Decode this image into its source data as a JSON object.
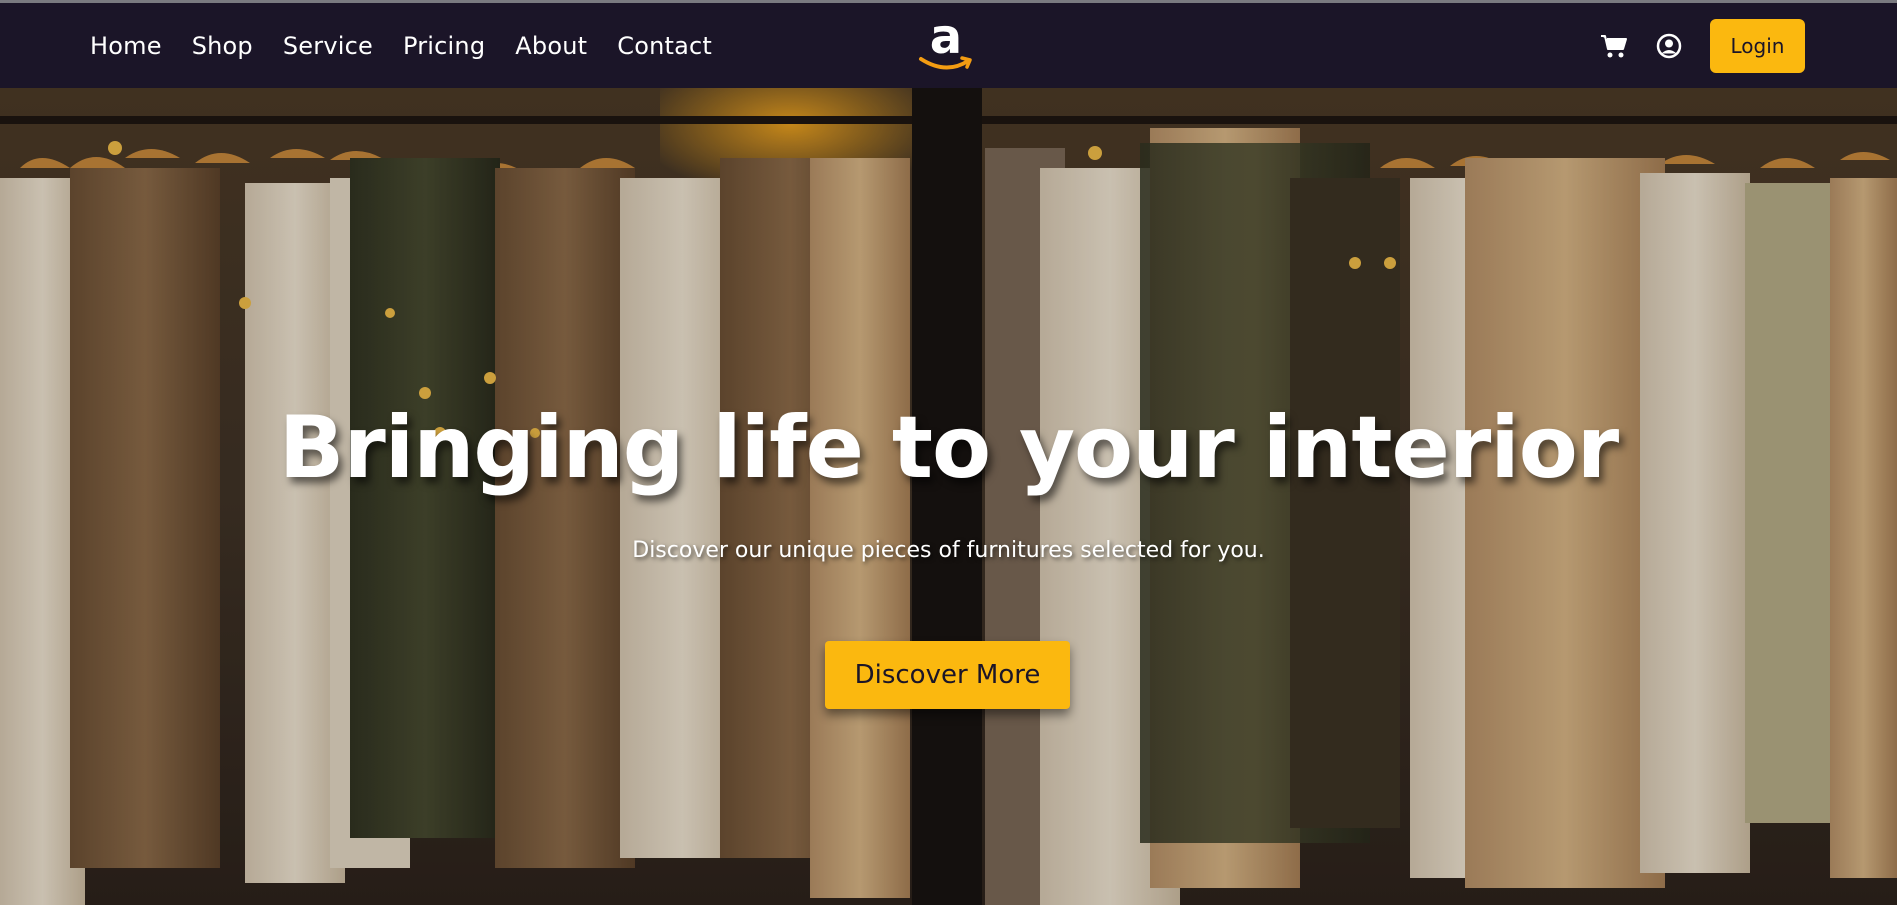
{
  "nav": {
    "links": [
      "Home",
      "Shop",
      "Service",
      "Pricing",
      "About",
      "Contact"
    ],
    "logo_letter": "a",
    "login_label": "Login",
    "icons": [
      "cart-icon",
      "user-circle-icon"
    ]
  },
  "hero": {
    "title": "Bringing life to your interior",
    "subtitle": "Discover our unique pieces of furnitures selected for you.",
    "cta_label": "Discover More",
    "image_description": "clothes on hangers on a rack"
  },
  "colors": {
    "navbar_bg": "#1b1528",
    "accent": "#fbb80f",
    "text_light": "#ffffff",
    "logo_smile": "#f39c12"
  }
}
